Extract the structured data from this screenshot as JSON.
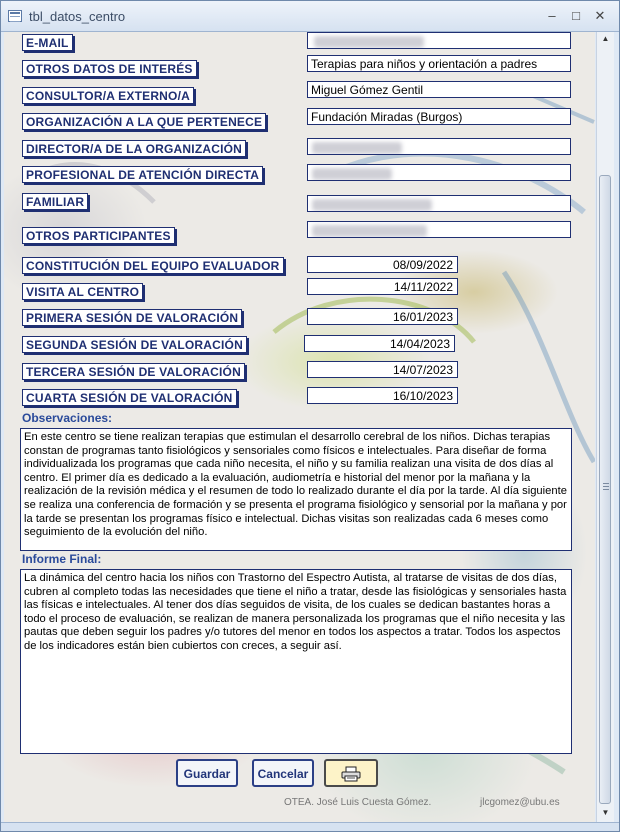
{
  "window": {
    "title": "tbl_datos_centro",
    "minimize": "–",
    "maximize": "□",
    "close": "✕"
  },
  "labels": {
    "email": "E-MAIL",
    "otros_datos": "OTROS DATOS DE INTERÉS",
    "consultor": "CONSULTOR/A EXTERNO/A",
    "organizacion": "ORGANIZACIÓN A LA QUE PERTENECE",
    "director": "DIRECTOR/A DE LA ORGANIZACIÓN",
    "profesional": "PROFESIONAL DE ATENCIÓN DIRECTA",
    "familiar": "FAMILIAR",
    "otros_participantes": "OTROS PARTICIPANTES",
    "constitucion": "CONSTITUCIÓN DEL EQUIPO EVALUADOR",
    "visita": "VISITA AL CENTRO",
    "primera": "PRIMERA SESIÓN DE VALORACIÓN",
    "segunda": "SEGUNDA SESIÓN DE VALORACIÓN",
    "tercera": "TERCERA SESIÓN DE VALORACIÓN",
    "cuarta": "CUARTA SESIÓN DE VALORACIÓN"
  },
  "fields": {
    "otros_datos": "Terapias para niños y orientación a padres",
    "consultor": "Miguel Gómez Gentil",
    "organizacion": "Fundación Miradas (Burgos)",
    "constitucion": "08/09/2022",
    "visita": "14/11/2022",
    "primera": "16/01/2023",
    "segunda": "14/04/2023",
    "tercera": "14/07/2023",
    "cuarta": "16/10/2023"
  },
  "observaciones": {
    "label": "Observaciones:",
    "text": "En este centro se tiene realizan terapias que estimulan el desarrollo cerebral de los niños. Dichas terapias constan de programas tanto fisiológicos y sensoriales como físicos e intelectuales. Para diseñar de forma individualizada los programas que cada niño necesita, el niño y su familia realizan una visita de dos días al centro. El primer día es dedicado a la evaluación, audiometría e historial del menor por la mañana y la realización de la revisión médica y el resumen de todo lo realizado durante el día por la tarde. Al día siguiente se realiza una conferencia de formación y se presenta el programa fisiológico y sensorial por la mañana y por la tarde se presentan los programas físico e intelectual. Dichas visitas son realizadas cada 6 meses como seguimiento de la evolución del niño."
  },
  "informe": {
    "label": "Informe Final:",
    "text": "La dinámica del centro hacia los niños con Trastorno del Espectro Autista, al tratarse de visitas de dos días, cubren al completo todas las necesidades que tiene el niño a tratar, desde las fisiológicas y sensoriales hasta las físicas e intelectuales. Al tener dos días seguidos de visita, de los cuales se dedican bastantes horas a todo el proceso de evaluación, se realizan de manera personalizada los programas que el niño necesita y las pautas que deben seguir los padres y/o tutores del menor en todos los aspectos a tratar. Todos los aspectos de los indicadores están bien cubiertos con creces, a seguir así."
  },
  "buttons": {
    "guardar": "Guardar",
    "cancelar": "Cancelar",
    "imprimir_icon": "printer-icon"
  },
  "footer": {
    "author": "OTEA. José Luis Cuesta Gómez.",
    "email": "jlcgomez@ubu.es"
  }
}
